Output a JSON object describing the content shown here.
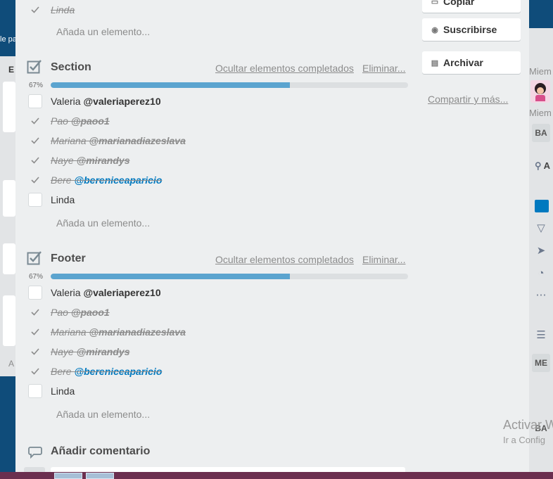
{
  "background": {
    "left_text": "le pa",
    "left_letter": "E",
    "left_bottom": "A",
    "right_labels": [
      "Miem",
      "Miem"
    ],
    "right_boxes": [
      "BA",
      "ME",
      "BA"
    ],
    "right_add_label": "A"
  },
  "sidebar": {
    "copy_label": "Copiar",
    "subscribe_label": "Suscribirse",
    "archive_label": "Archivar",
    "share_label": "Compartir y más..."
  },
  "top_item": {
    "label": "Linda",
    "add": "Añada un elemento..."
  },
  "checklists": [
    {
      "title": "Section",
      "hide_label": "Ocultar elementos completados",
      "delete_label": "Eliminar...",
      "progress_label": "67%",
      "progress": 0.67,
      "add_label": "Añada un elemento...",
      "items": [
        {
          "name": "Valeria",
          "mention": "@valeriaperez10"
        },
        {
          "name": "Pao",
          "mention": "@paoo1"
        },
        {
          "name": "Mariana",
          "mention": "@marianadiazeslava"
        },
        {
          "name": "Naye",
          "mention": "@mirandys"
        },
        {
          "name": "Bere",
          "mention": "@bereniceaparicio"
        },
        {
          "name": "Linda",
          "mention": ""
        }
      ]
    },
    {
      "title": "Footer",
      "hide_label": "Ocultar elementos completados",
      "delete_label": "Eliminar...",
      "progress_label": "67%",
      "progress": 0.67,
      "add_label": "Añada un elemento...",
      "items": [
        {
          "name": "Valeria",
          "mention": "@valeriaperez10"
        },
        {
          "name": "Pao",
          "mention": "@paoo1"
        },
        {
          "name": "Mariana",
          "mention": "@marianadiazeslava"
        },
        {
          "name": "Naye",
          "mention": "@mirandys"
        },
        {
          "name": "Bere",
          "mention": "@bereniceaparicio"
        },
        {
          "name": "Linda",
          "mention": ""
        }
      ]
    }
  ],
  "comment": {
    "title": "Añadir comentario"
  },
  "watermark": {
    "line1": "Activar W",
    "line2": "Ir a Config"
  },
  "colors": {
    "progress": "#5ba4cf",
    "mention_link": "#0079bf",
    "accent_right": "#0079bf"
  }
}
